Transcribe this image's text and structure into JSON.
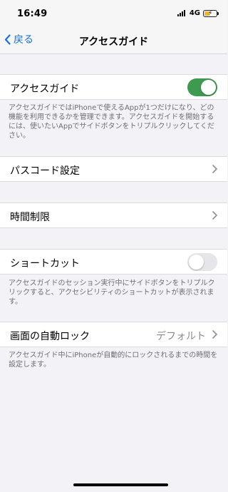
{
  "status_bar": {
    "time": "16:49",
    "network": "4G",
    "battery_level": 0.45,
    "battery_color": "#f0b33a"
  },
  "nav": {
    "back_label": "戻る",
    "title": "アクセスガイド",
    "accent_color": "#1673db"
  },
  "guided_access": {
    "label": "アクセスガイド",
    "toggle_on": true,
    "footer": "アクセスガイドではiPhoneで使えるAppが1つだけになり、どの機能を利用できるかを管理できます。アクセスガイドを開始するには、使いたいAppでサイドボタンをトリプルクリックしてください。"
  },
  "passcode": {
    "label": "パスコード設定"
  },
  "time_limits": {
    "label": "時間制限"
  },
  "shortcut": {
    "label": "ショートカット",
    "toggle_on": false,
    "footer": "アクセスガイドのセッション実行中にサイドボタンをトリプルクリックすると、アクセシビリティのショートカットが表示されます。"
  },
  "auto_lock": {
    "label": "画面の自動ロック",
    "value": "デフォルト",
    "footer": "アクセスガイド中にiPhoneが自動的にロックされるまでの時間を設定します。"
  },
  "icons": {
    "back": "chevron-left-icon",
    "row_arrow": "chevron-right-icon",
    "signal": "cellular-signal-icon",
    "battery": "battery-charging-icon"
  },
  "colors": {
    "toggle_on": "#3e9a4f",
    "toggle_off": "#e5e5ea",
    "background": "#f2f2f7"
  }
}
